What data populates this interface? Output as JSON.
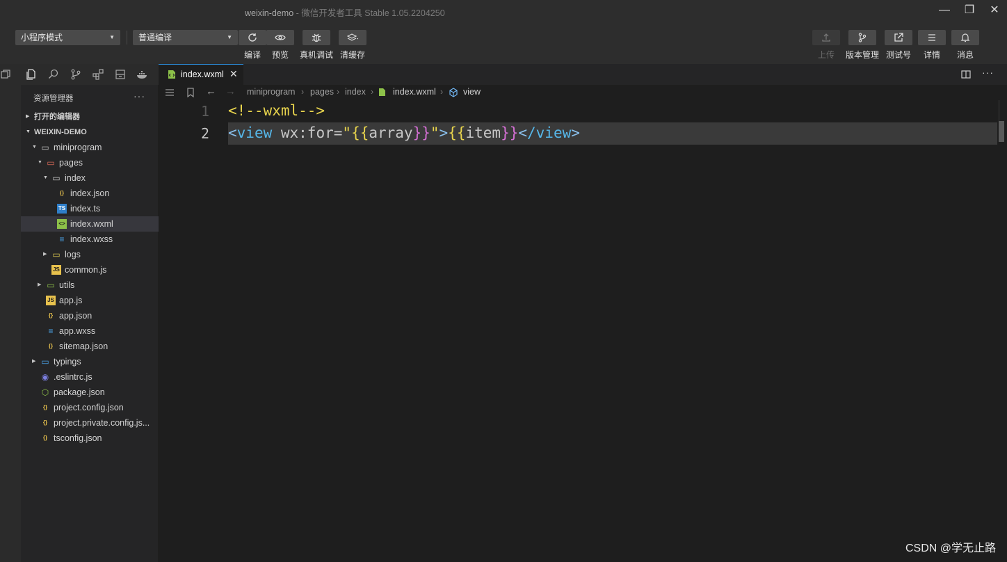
{
  "window": {
    "title": "weixin-demo",
    "subtitle": "- 微信开发者工具 Stable 1.05.2204250",
    "minimize": "—",
    "maximize": "❐",
    "close": "✕"
  },
  "toolbar": {
    "mode_select": "小程序模式",
    "compile_select": "普通编译",
    "buttons": [
      {
        "label": "编译",
        "icon": "refresh-icon"
      },
      {
        "label": "预览",
        "icon": "eye-icon"
      },
      {
        "label": "真机调试",
        "icon": "bug-icon"
      },
      {
        "label": "清缓存",
        "icon": "layers-icon"
      }
    ],
    "right_buttons": [
      {
        "label": "上传",
        "icon": "upload-icon",
        "disabled": true
      },
      {
        "label": "版本管理",
        "icon": "branch-icon"
      },
      {
        "label": "测试号",
        "icon": "external-link-icon"
      },
      {
        "label": "详情",
        "icon": "menu-icon"
      },
      {
        "label": "消息",
        "icon": "bell-icon"
      }
    ]
  },
  "sidebar": {
    "title": "资源管理器",
    "more": "···",
    "open_editors": "打开的编辑器",
    "project": "WEIXIN-DEMO",
    "tree": [
      {
        "name": "miniprogram",
        "type": "folder",
        "depth": 1,
        "expanded": true
      },
      {
        "name": "pages",
        "type": "folder-red",
        "depth": 2,
        "expanded": true
      },
      {
        "name": "index",
        "type": "folder",
        "depth": 3,
        "expanded": true
      },
      {
        "name": "index.json",
        "type": "json",
        "depth": 4
      },
      {
        "name": "index.ts",
        "type": "ts",
        "depth": 4
      },
      {
        "name": "index.wxml",
        "type": "wxml",
        "depth": 4,
        "selected": true
      },
      {
        "name": "index.wxss",
        "type": "css",
        "depth": 4
      },
      {
        "name": "logs",
        "type": "folder-yellow",
        "depth": 3,
        "expanded": false
      },
      {
        "name": "common.js",
        "type": "js",
        "depth": 3
      },
      {
        "name": "utils",
        "type": "folder-green",
        "depth": 2,
        "expanded": false
      },
      {
        "name": "app.js",
        "type": "js",
        "depth": 2
      },
      {
        "name": "app.json",
        "type": "json",
        "depth": 2
      },
      {
        "name": "app.wxss",
        "type": "css",
        "depth": 2
      },
      {
        "name": "sitemap.json",
        "type": "json",
        "depth": 2
      },
      {
        "name": "typings",
        "type": "folder-blue",
        "depth": 1,
        "expanded": false
      },
      {
        "name": ".eslintrc.js",
        "type": "eslint",
        "depth": 1
      },
      {
        "name": "package.json",
        "type": "npm",
        "depth": 1
      },
      {
        "name": "project.config.json",
        "type": "json",
        "depth": 1
      },
      {
        "name": "project.private.config.js...",
        "type": "json",
        "depth": 1
      },
      {
        "name": "tsconfig.json",
        "type": "json",
        "depth": 1
      }
    ]
  },
  "editor": {
    "tab_name": "index.wxml",
    "tab_close": "✕",
    "breadcrumb": [
      "miniprogram",
      "pages",
      "index",
      "index.wxml",
      "view"
    ],
    "lines": [
      {
        "num": "1",
        "tokens": [
          {
            "t": "<!--wxml-->",
            "c": "#e8d44d"
          }
        ]
      },
      {
        "num": "2",
        "tokens": [
          {
            "t": "<",
            "c": "#8ac0ec"
          },
          {
            "t": "view",
            "c": "#56b6e8"
          },
          {
            "t": " wx:for",
            "c": "#c7c7c7"
          },
          {
            "t": "=",
            "c": "#c7c7c7"
          },
          {
            "t": "\"",
            "c": "#e8d44d"
          },
          {
            "t": "{{",
            "c": "#e8d44d"
          },
          {
            "t": "array",
            "c": "#c7c7c7"
          },
          {
            "t": "}}",
            "c": "#d670d6"
          },
          {
            "t": "\"",
            "c": "#e8d44d"
          },
          {
            "t": ">",
            "c": "#8ac0ec"
          },
          {
            "t": "{{",
            "c": "#e8d44d"
          },
          {
            "t": "item",
            "c": "#c7c7c7"
          },
          {
            "t": "}}",
            "c": "#d670d6"
          },
          {
            "t": "<",
            "c": "#8ac0ec"
          },
          {
            "t": "/view",
            "c": "#56b6e8"
          },
          {
            "t": ">",
            "c": "#8ac0ec"
          }
        ]
      }
    ]
  },
  "watermark": "CSDN @学无止路"
}
